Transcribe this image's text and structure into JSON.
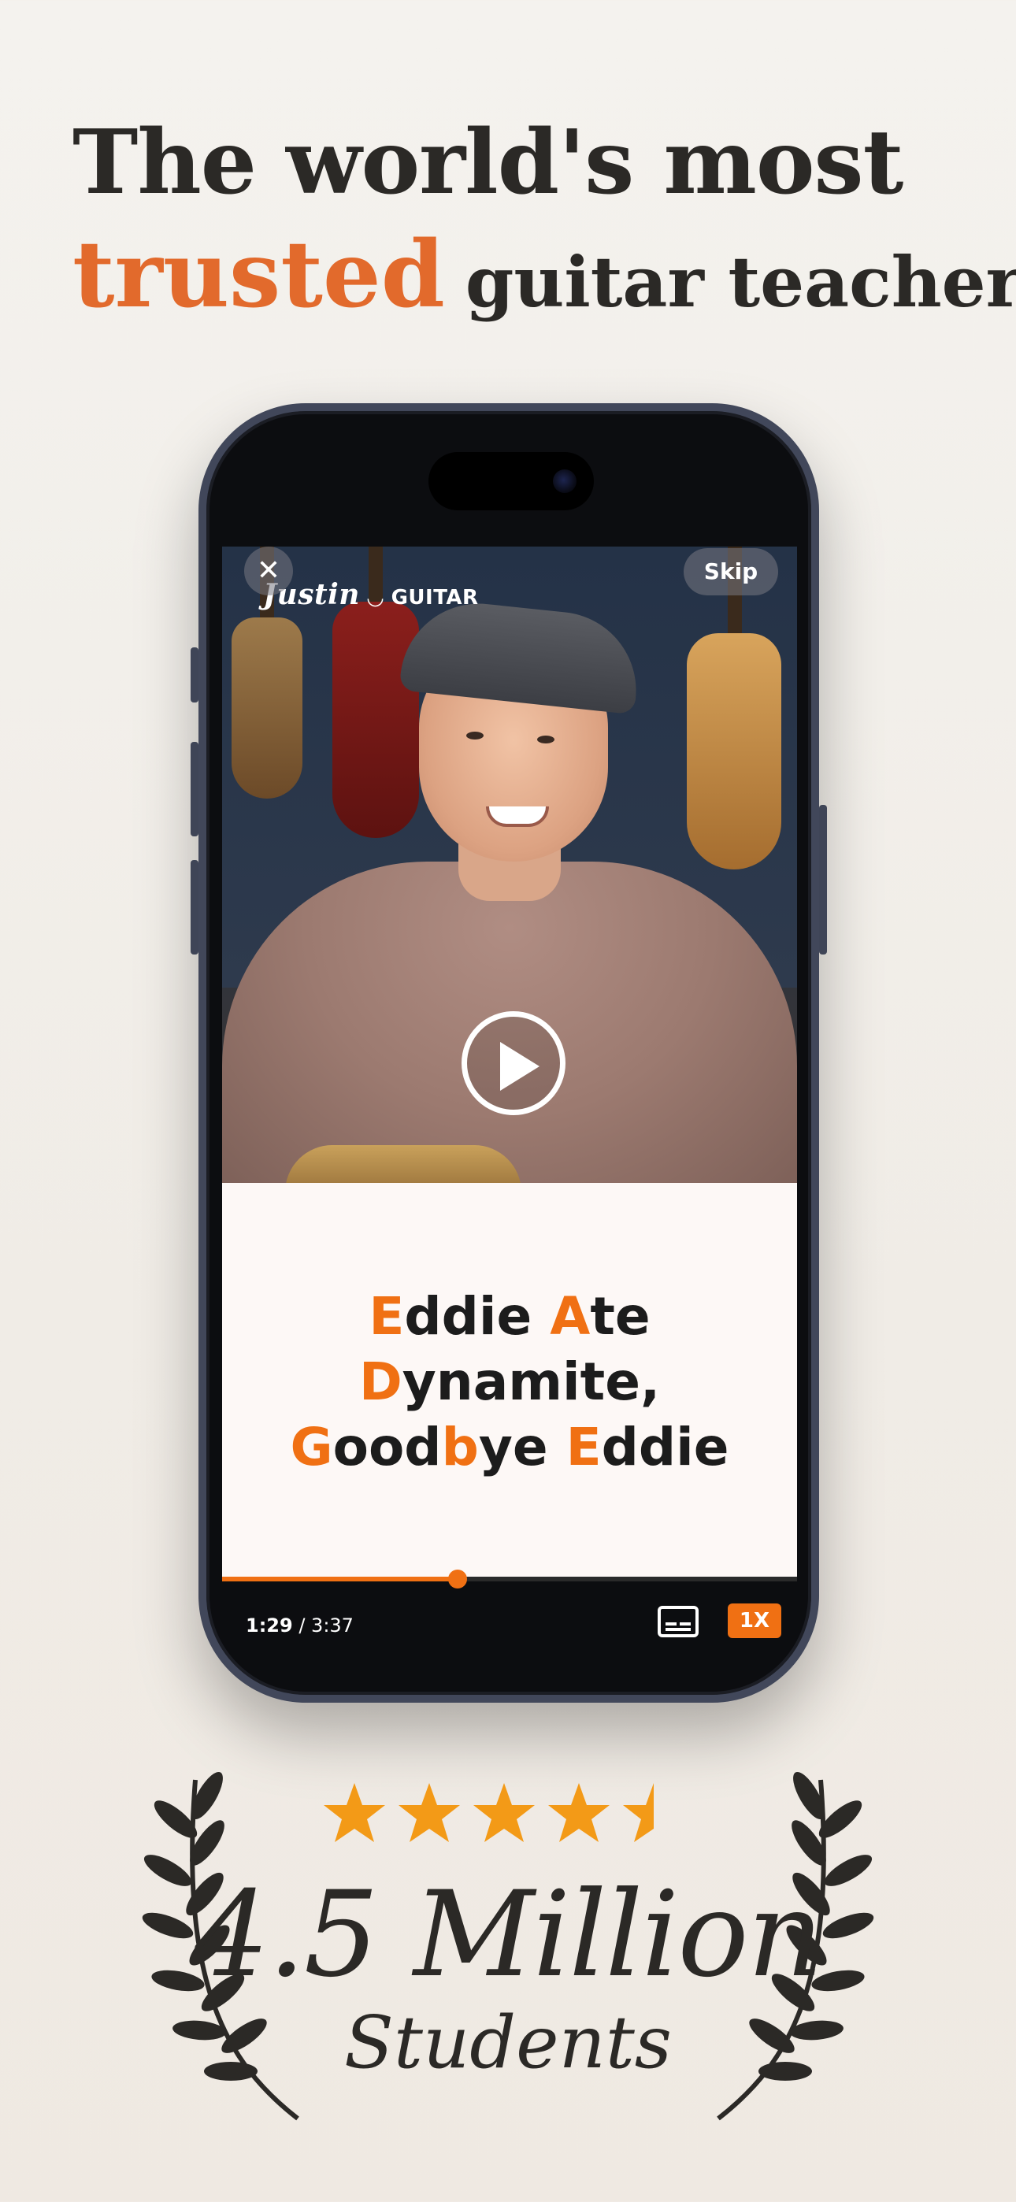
{
  "headline": {
    "line1": "The world's most",
    "accent": "trusted",
    "rest": "guitar teacher."
  },
  "video": {
    "logo_script": "Justin",
    "logo_text": "GUITAR",
    "skip_label": "Skip",
    "close_icon": "close-icon",
    "play_icon": "play-icon"
  },
  "lyrics": {
    "line1": [
      "E",
      "ddie ",
      "A",
      "te"
    ],
    "line2": [
      "D",
      "ynamite,"
    ],
    "line3": [
      "G",
      "ood",
      "b",
      "ye ",
      "E",
      "ddie"
    ]
  },
  "player": {
    "current_time": "1:29",
    "separator": " / ",
    "duration": "3:37",
    "progress_fraction": 0.41,
    "speed_label": "1X",
    "captions_icon": "captions-icon"
  },
  "rating": {
    "stars": 4.5,
    "count": "4.5 Million",
    "label": "Students"
  },
  "colors": {
    "accent": "#e26a2c",
    "player_orange": "#f07013",
    "star": "#f39a17",
    "text_dark": "#2b2926"
  }
}
